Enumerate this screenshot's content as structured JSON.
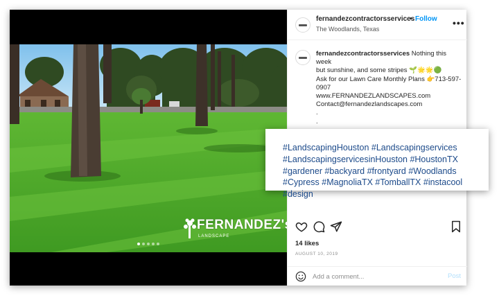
{
  "post": {
    "username": "fernandezcontractorsservices",
    "separator": "•",
    "follow_label": "Follow",
    "location": "The Woodlands, Texas",
    "more_icon": "•••",
    "caption": {
      "username": "fernandezcontractorsservices",
      "line1": " Nothing this week",
      "line2": "but sunshine, and some stripes 🌱🌟🌟🟢",
      "line3": "Ask for our Lawn Care Monthly Plans 👉713-597-",
      "line4": "0907",
      "line5": "www.FERNANDEZLANDSCAPES.com",
      "line6": "Contact@fernandezlandscapes.com",
      "dots": [
        ".",
        ".",
        "."
      ]
    },
    "likes": "14 likes",
    "date": "AUGUST 10, 2019",
    "comment_placeholder": "Add a comment...",
    "post_label": "Post",
    "carousel": {
      "count": 5,
      "active_index": 0
    }
  },
  "watermark": {
    "title": "FERNANDEZ's",
    "subtitle": "LANDSCAPE"
  },
  "hashtags": {
    "line1": "#LandscapingHouston #Landscapingservices",
    "line2": "#LandscapingservicesinHouston #HoustonTX",
    "line3": "#gardener #backyard #frontyard #Woodlands",
    "line4": "#Cypress #MagnoliaTX #TomballTX #instacool",
    "line5": "#design"
  },
  "colors": {
    "follow": "#0095f6",
    "hashtag": "#1c4a8a",
    "grass": "#4caf2f",
    "sky": "#9ed0f0"
  }
}
